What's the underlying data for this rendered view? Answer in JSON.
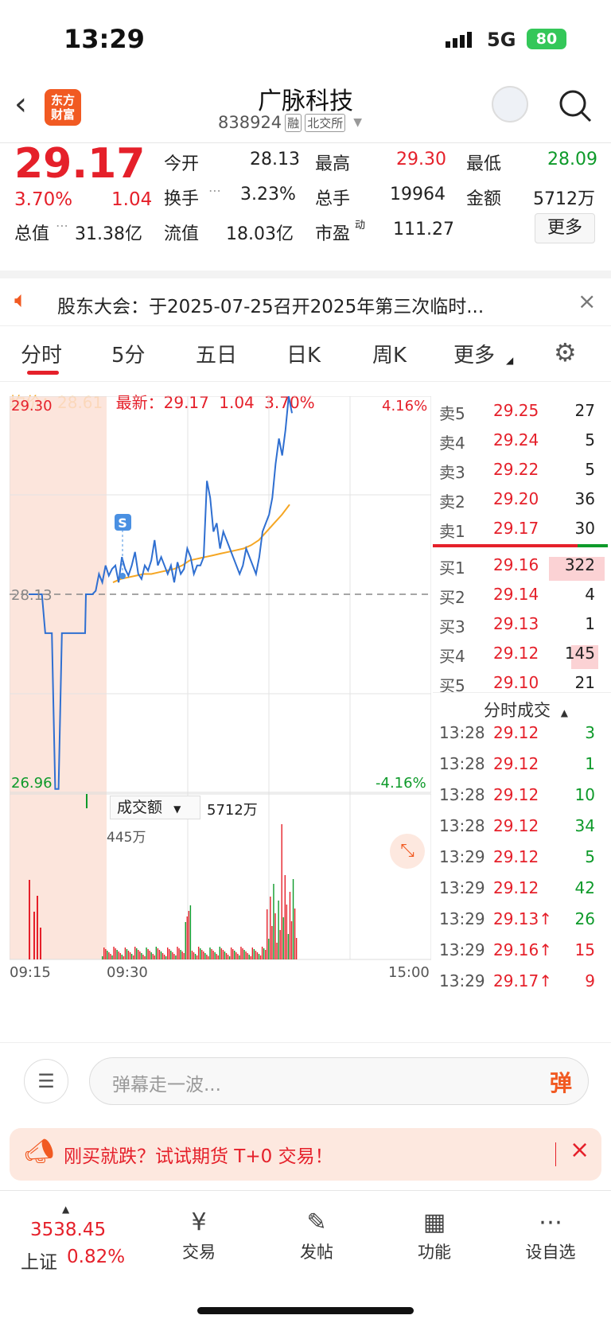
{
  "status": {
    "time": "13:29",
    "network": "5G",
    "battery": "80"
  },
  "header": {
    "logo_line1": "东方",
    "logo_line2": "财富",
    "stock_name": "广脉科技",
    "code": "838924",
    "tag_margin": "融",
    "tag_exchange": "北交所"
  },
  "quote": {
    "price": "29.17",
    "pct": "3.70%",
    "chg": "1.04",
    "open_label": "今开",
    "open": "28.13",
    "high_label": "最高",
    "high": "29.30",
    "low_label": "最低",
    "low": "28.09",
    "turnover_label": "换手",
    "turnover": "3.23%",
    "volume_label": "总手",
    "volume": "19964",
    "amount_label": "金额",
    "amount": "5712万",
    "mktcap_label": "总值",
    "mktcap": "31.38亿",
    "float_label": "流值",
    "float": "18.03亿",
    "pe_label": "市盈",
    "pe_sup": "动",
    "pe": "111.27",
    "more": "更多"
  },
  "notice": {
    "text": "股东大会：于2025-07-25召开2025年第三次临时..."
  },
  "tabs": [
    "分时",
    "5分",
    "五日",
    "日K",
    "周K",
    "更多"
  ],
  "info": {
    "avg_label": "均价：",
    "avg": "28.61",
    "latest_label": "最新：",
    "latest": "29.17",
    "chg": "1.04",
    "pct": "3.70%"
  },
  "chart": {
    "ymax": "29.30",
    "ymid": "28.13",
    "ymin": "26.96",
    "pmax": "4.16%",
    "pmin": "-4.16%",
    "marker": "S",
    "vol_selector": "成交额",
    "vol_total": "5712万",
    "vol_max": "445万",
    "t_start": "09:15",
    "t_open": "09:30",
    "t_end": "15:00"
  },
  "chart_data": {
    "type": "line",
    "price_range": [
      26.96,
      29.3
    ],
    "pre_close": 28.13,
    "price": [
      28.13,
      28.13,
      28.13,
      28.13,
      28.13,
      27.9,
      27.9,
      27.9,
      26.98,
      26.98,
      27.9,
      27.9,
      27.9,
      27.9,
      27.9,
      27.9,
      27.9,
      27.9,
      28.13,
      28.13,
      28.13,
      28.15,
      28.25,
      28.2,
      28.3,
      28.24,
      28.28,
      28.3,
      28.2,
      28.35,
      28.28,
      28.24,
      28.3,
      28.38,
      28.25,
      28.22,
      28.3,
      28.27,
      28.33,
      28.45,
      28.3,
      28.35,
      28.3,
      28.25,
      28.3,
      28.2,
      28.32,
      28.25,
      28.28,
      28.4,
      28.35,
      28.25,
      28.3,
      28.3,
      28.35,
      28.8,
      28.7,
      28.5,
      28.55,
      28.4,
      28.5,
      28.45,
      28.4,
      28.35,
      28.3,
      28.25,
      28.3,
      28.4,
      28.35,
      28.3,
      28.25,
      28.35,
      28.5,
      28.55,
      28.6,
      28.7,
      28.9,
      29.05,
      28.95,
      29.1,
      29.3,
      29.2
    ],
    "avg": [
      28.2,
      28.22,
      28.23,
      28.24,
      28.25,
      28.25,
      28.26,
      28.27,
      28.28,
      28.3,
      28.33,
      28.34,
      28.35,
      28.36,
      28.37,
      28.38,
      28.39,
      28.4,
      28.42,
      28.45,
      28.5,
      28.55,
      28.6,
      28.66
    ]
  },
  "orderbook": {
    "asks": [
      {
        "label": "卖5",
        "price": "29.25",
        "vol": "27"
      },
      {
        "label": "卖4",
        "price": "29.24",
        "vol": "5"
      },
      {
        "label": "卖3",
        "price": "29.22",
        "vol": "5"
      },
      {
        "label": "卖2",
        "price": "29.20",
        "vol": "36"
      },
      {
        "label": "卖1",
        "price": "29.17",
        "vol": "30"
      }
    ],
    "bids": [
      {
        "label": "买1",
        "price": "29.16",
        "vol": "322"
      },
      {
        "label": "买2",
        "price": "29.14",
        "vol": "4"
      },
      {
        "label": "买3",
        "price": "29.13",
        "vol": "1"
      },
      {
        "label": "买4",
        "price": "29.12",
        "vol": "145"
      },
      {
        "label": "买5",
        "price": "29.10",
        "vol": "21"
      }
    ]
  },
  "ticks": {
    "title": "分时成交",
    "rows": [
      {
        "t": "13:28",
        "p": "29.12",
        "v": "3",
        "c": "green"
      },
      {
        "t": "13:28",
        "p": "29.12",
        "v": "1",
        "c": "green"
      },
      {
        "t": "13:28",
        "p": "29.12",
        "v": "10",
        "c": "green"
      },
      {
        "t": "13:28",
        "p": "29.12",
        "v": "34",
        "c": "green"
      },
      {
        "t": "13:29",
        "p": "29.12",
        "v": "5",
        "c": "green"
      },
      {
        "t": "13:29",
        "p": "29.12",
        "v": "42",
        "c": "green"
      },
      {
        "t": "13:29",
        "p": "29.13↑",
        "v": "26",
        "c": "green"
      },
      {
        "t": "13:29",
        "p": "29.16↑",
        "v": "15",
        "c": "red"
      },
      {
        "t": "13:29",
        "p": "29.17↑",
        "v": "9",
        "c": "red"
      }
    ]
  },
  "comment": {
    "placeholder": "弹幕走一波...",
    "btn": "弹"
  },
  "ad": {
    "text": "刚买就跌？试试期货 T+0 交易！"
  },
  "nav": {
    "index_value": "3538.45",
    "index_name": "上证",
    "index_pct": "0.82%",
    "items": [
      "交易",
      "发帖",
      "功能",
      "设自选"
    ]
  },
  "colors": {
    "red": "#e5202a",
    "green": "#0e9a2a",
    "brand": "#f15a22",
    "avg_line": "#f5a623",
    "price_line": "#2f6fd1"
  }
}
